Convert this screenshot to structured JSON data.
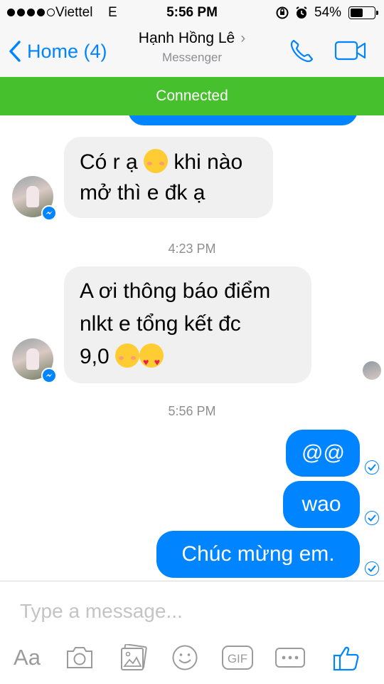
{
  "status_bar": {
    "carrier": "Viettel",
    "network": "E",
    "time": "5:56 PM",
    "battery_percent": "54%",
    "battery_level": 0.54
  },
  "nav": {
    "back_label": "Home (4)",
    "contact_name": "Hạnh Hồng Lê",
    "contact_subtitle": "Messenger"
  },
  "banner": {
    "text": "Connected",
    "color": "#46c02c"
  },
  "messages": {
    "in_1": {
      "line1": "Có r ạ",
      "line1b": "khi nào",
      "line2": "mở thì e đk ạ"
    },
    "timestamp_1": "4:23 PM",
    "in_2": {
      "line1": "A ơi thông báo điểm",
      "line2": "nlkt e tổng kết đc",
      "line3": "9,0"
    },
    "timestamp_2": "5:56 PM",
    "out_1": "@@",
    "out_2": "wao",
    "out_3": "Chúc mừng em."
  },
  "composer": {
    "placeholder": "Type a message...",
    "aa_label": "Aa",
    "icons": [
      "camera-icon",
      "photo-icon",
      "emoji-icon",
      "gif-icon",
      "more-icon",
      "like-icon"
    ]
  },
  "colors": {
    "accent": "#0084ff",
    "incoming_bubble": "#f0f0f0",
    "muted": "#8e8e93"
  }
}
